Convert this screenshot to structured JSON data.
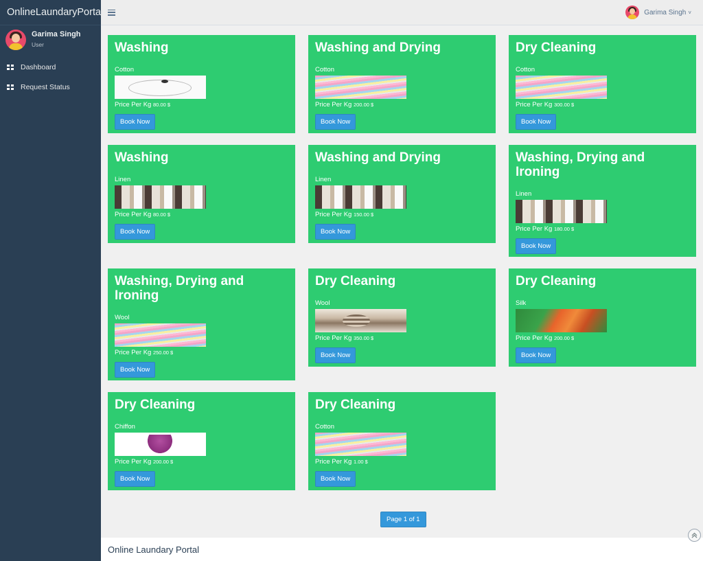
{
  "app": {
    "brand": "OnlineLaundaryPortal"
  },
  "profile": {
    "name": "Garima Singh",
    "role": "User"
  },
  "sidebar": {
    "items": [
      {
        "label": "Dashboard",
        "icon": "dashboard-icon"
      },
      {
        "label": "Request Status",
        "icon": "dashboard-icon"
      }
    ]
  },
  "topbar": {
    "user_name": "Garima Singh",
    "caret": "˅"
  },
  "colors": {
    "card": "#2ecc71",
    "button": "#3498db",
    "sidebar": "#2a3f54"
  },
  "cards": [
    {
      "title": "Washing",
      "fabric": "Cotton",
      "price_label": "Price Per Kg",
      "price": "80.00 $",
      "button": "Book Now"
    },
    {
      "title": "Washing and Drying",
      "fabric": "Cotton",
      "price_label": "Price Per Kg",
      "price": "200.00 $",
      "button": "Book Now"
    },
    {
      "title": "Dry Cleaning",
      "fabric": "Cotton",
      "price_label": "Price Per Kg",
      "price": "300.00 $",
      "button": "Book Now"
    },
    {
      "title": "Washing",
      "fabric": "Linen",
      "price_label": "Price Per Kg",
      "price": "80.00 $",
      "button": "Book Now"
    },
    {
      "title": "Washing and Drying",
      "fabric": "Linen",
      "price_label": "Price Per Kg",
      "price": "150.00 $",
      "button": "Book Now"
    },
    {
      "title": "Washing, Drying and Ironing",
      "fabric": "Linen",
      "price_label": "Price Per Kg",
      "price": "180.00 $",
      "button": "Book Now"
    },
    {
      "title": "Washing, Drying and Ironing",
      "fabric": "Wool",
      "price_label": "Price Per Kg",
      "price": "250.00 $",
      "button": "Book Now"
    },
    {
      "title": "Dry Cleaning",
      "fabric": "Wool",
      "price_label": "Price Per Kg",
      "price": "350.00 $",
      "button": "Book Now"
    },
    {
      "title": "Dry Cleaning",
      "fabric": "Silk",
      "price_label": "Price Per Kg",
      "price": "200.00 $",
      "button": "Book Now"
    },
    {
      "title": "Dry Cleaning",
      "fabric": "Chiffon",
      "price_label": "Price Per Kg",
      "price": "200.00 $",
      "button": "Book Now"
    },
    {
      "title": "Dry Cleaning",
      "fabric": "Cotton",
      "price_label": "Price Per Kg",
      "price": "1.00 $",
      "button": "Book Now"
    }
  ],
  "pagination": {
    "label": "Page 1 of 1"
  },
  "footer": {
    "text": "Online Laundary Portal"
  }
}
